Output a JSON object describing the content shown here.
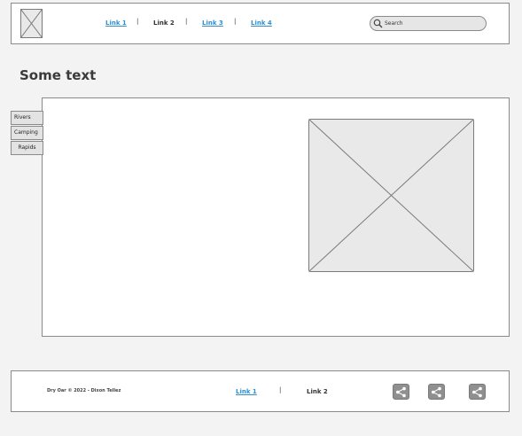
{
  "header": {
    "nav": [
      {
        "label": "Link 1",
        "style": "link"
      },
      {
        "label": "Link 2",
        "style": "plain"
      },
      {
        "label": "Link 3",
        "style": "link"
      },
      {
        "label": "Link 4",
        "style": "link"
      }
    ],
    "separator": "|",
    "search": {
      "placeholder": "Search",
      "icon": "search-icon"
    }
  },
  "main": {
    "heading": "Some text",
    "side_tabs": [
      "Rivers",
      "Camping",
      "Rapids"
    ]
  },
  "footer": {
    "copyright": "Dry Oar © 2022 - Dixon Tellez",
    "links": [
      "Link 1",
      "Link 2"
    ],
    "separator": "|",
    "share_icons": [
      "share-icon",
      "share-icon",
      "share-icon"
    ]
  },
  "colors": {
    "link": "#2f8fd1",
    "background": "#f3f3f3",
    "border": "#8a8a8a",
    "placeholder_fill": "#e9e9e9"
  }
}
